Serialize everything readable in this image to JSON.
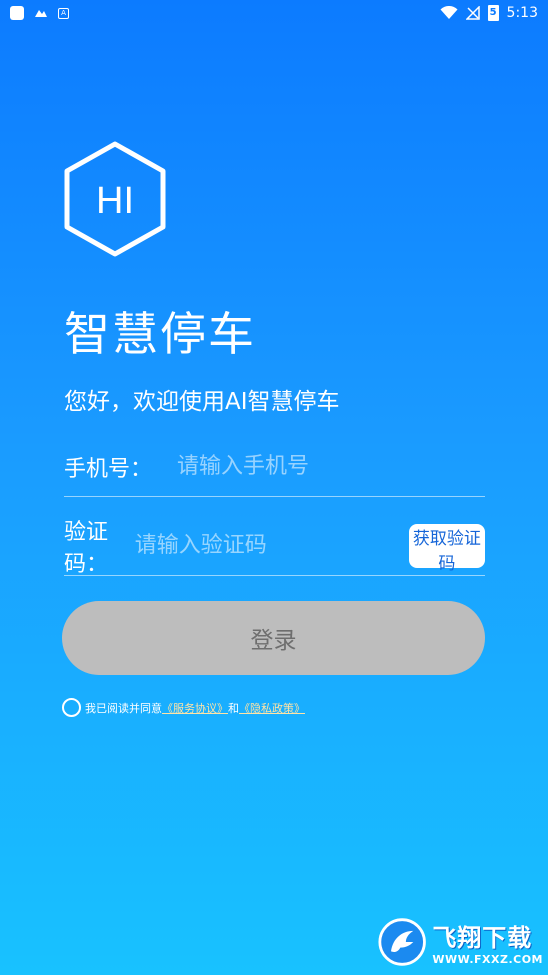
{
  "status_bar": {
    "time": "5:13",
    "battery_level": "5",
    "left_icons": [
      "app-square-icon",
      "notification-icon",
      "a-icon"
    ],
    "right_icons": [
      "wifi-icon",
      "no-signal-icon",
      "battery-icon"
    ]
  },
  "app": {
    "logo_text": "HI",
    "title": "智慧停车",
    "welcome": "您好，欢迎使用AI智慧停车"
  },
  "form": {
    "phone_label": "手机号：",
    "phone_placeholder": "请输入手机号",
    "phone_value": "",
    "code_label": "验证码：",
    "code_placeholder": "请输入验证码",
    "code_value": "",
    "get_code_label": "获取验证码",
    "login_label": "登录"
  },
  "agreement": {
    "checked": false,
    "prefix": "我已阅读并同意",
    "service_link": "《服务协议》",
    "conjunction": "和",
    "privacy_link": "《隐私政策》"
  },
  "watermark": {
    "cn": "飞翔下载",
    "en": "WWW.FXXZ.COM"
  },
  "colors": {
    "gradient_top": "#0c7bff",
    "gradient_bottom": "#18c2ff",
    "login_button": "#bdbdbd",
    "get_code_text": "#1565d8"
  }
}
